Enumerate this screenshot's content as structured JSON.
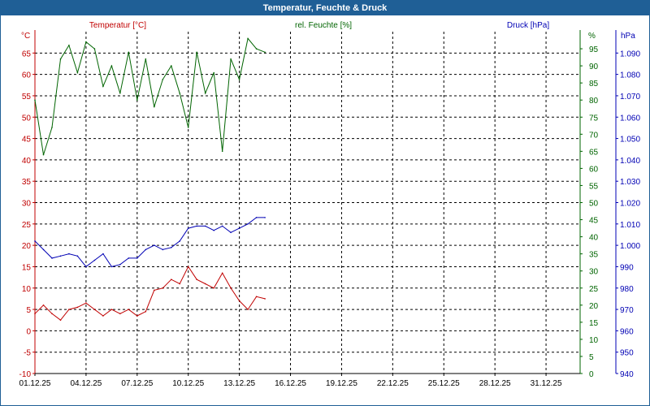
{
  "window": {
    "title": "Temperatur, Feuchte & Druck"
  },
  "colors": {
    "titlebar": "#1f5f96",
    "temperature": "#c00000",
    "humidity": "#006400",
    "pressure": "#0000b4",
    "grid": "#000000"
  },
  "chart_data": {
    "type": "line",
    "title": "Temperatur, Feuchte & Druck",
    "grid": true,
    "x_tick_labels": [
      "01.12.25",
      "04.12.25",
      "07.12.25",
      "10.12.25",
      "13.12.25",
      "16.12.25",
      "19.12.25",
      "22.12.25",
      "25.12.25",
      "28.12.25",
      "31.12.25"
    ],
    "xlim": [
      "2025-12-01",
      "2026-01-02"
    ],
    "axes": {
      "left": {
        "label": "Temperatur [°C]",
        "unit": "°C",
        "ylim": [
          -10,
          70
        ],
        "ticks": [
          -10,
          -5,
          0,
          5,
          10,
          15,
          20,
          25,
          30,
          35,
          40,
          45,
          50,
          55,
          60,
          65
        ]
      },
      "right1": {
        "label": "rel. Feuchte [%]",
        "unit": "%",
        "ylim": [
          0,
          100
        ],
        "ticks": [
          0,
          5,
          10,
          15,
          20,
          25,
          30,
          35,
          40,
          45,
          50,
          55,
          60,
          65,
          70,
          75,
          80,
          85,
          90,
          95
        ]
      },
      "right2": {
        "label": "Druck [hPa]",
        "unit": "hPa",
        "ylim": [
          940,
          1100
        ],
        "ticks": [
          "940",
          "950",
          "960",
          "970",
          "980",
          "990",
          "1.000",
          "1.010",
          "1.020",
          "1.030",
          "1.040",
          "1.050",
          "1.060",
          "1.070",
          "1.080",
          "1.090"
        ]
      }
    },
    "series": [
      {
        "name": "Temperatur [°C]",
        "axis": "left",
        "color": "#c00000",
        "x": [
          "2025-12-01",
          "2025-12-01T12:00",
          "2025-12-02",
          "2025-12-02T12:00",
          "2025-12-03",
          "2025-12-03T12:00",
          "2025-12-04",
          "2025-12-04T12:00",
          "2025-12-05",
          "2025-12-05T12:00",
          "2025-12-06",
          "2025-12-06T12:00",
          "2025-12-07",
          "2025-12-07T12:00",
          "2025-12-08",
          "2025-12-08T12:00",
          "2025-12-09",
          "2025-12-09T12:00",
          "2025-12-10",
          "2025-12-10T12:00",
          "2025-12-11",
          "2025-12-11T12:00",
          "2025-12-12",
          "2025-12-12T12:00",
          "2025-12-13",
          "2025-12-13T12:00",
          "2025-12-14",
          "2025-12-14T12:00"
        ],
        "values": [
          4,
          6,
          4,
          2.5,
          5,
          5.5,
          6.5,
          5,
          3.5,
          5,
          4,
          5,
          3.5,
          4.5,
          9.5,
          10,
          12,
          11,
          15,
          12,
          11,
          10,
          13.5,
          10,
          7,
          5,
          8,
          7.5
        ]
      },
      {
        "name": "rel. Feuchte [%]",
        "axis": "right1",
        "color": "#006400",
        "x": [
          "2025-12-01",
          "2025-12-01T12:00",
          "2025-12-02",
          "2025-12-02T12:00",
          "2025-12-03",
          "2025-12-03T12:00",
          "2025-12-04",
          "2025-12-04T12:00",
          "2025-12-05",
          "2025-12-05T12:00",
          "2025-12-06",
          "2025-12-06T12:00",
          "2025-12-07",
          "2025-12-07T12:00",
          "2025-12-08",
          "2025-12-08T12:00",
          "2025-12-09",
          "2025-12-09T12:00",
          "2025-12-10",
          "2025-12-10T12:00",
          "2025-12-11",
          "2025-12-11T12:00",
          "2025-12-12",
          "2025-12-12T12:00",
          "2025-12-13",
          "2025-12-13T12:00",
          "2025-12-14",
          "2025-12-14T12:00"
        ],
        "values": [
          80,
          64,
          72,
          92,
          96,
          88,
          97,
          95,
          84,
          90,
          82,
          94,
          80,
          92,
          78,
          86,
          90,
          82,
          72,
          94,
          82,
          88,
          65,
          92,
          86,
          98,
          95,
          94
        ]
      },
      {
        "name": "Druck [hPa]",
        "axis": "right2",
        "color": "#0000b4",
        "x": [
          "2025-12-01",
          "2025-12-01T12:00",
          "2025-12-02",
          "2025-12-02T12:00",
          "2025-12-03",
          "2025-12-03T12:00",
          "2025-12-04",
          "2025-12-04T12:00",
          "2025-12-05",
          "2025-12-05T12:00",
          "2025-12-06",
          "2025-12-06T12:00",
          "2025-12-07",
          "2025-12-07T12:00",
          "2025-12-08",
          "2025-12-08T12:00",
          "2025-12-09",
          "2025-12-09T12:00",
          "2025-12-10",
          "2025-12-10T12:00",
          "2025-12-11",
          "2025-12-11T12:00",
          "2025-12-12",
          "2025-12-12T12:00",
          "2025-12-13",
          "2025-12-13T12:00",
          "2025-12-14",
          "2025-12-14T12:00"
        ],
        "values": [
          1002,
          998,
          994,
          995,
          996,
          995,
          990,
          993,
          996,
          990,
          991,
          994,
          994,
          998,
          1000,
          998,
          999,
          1002,
          1008,
          1009,
          1009,
          1007,
          1009,
          1006,
          1008,
          1010,
          1013,
          1013
        ]
      }
    ]
  }
}
